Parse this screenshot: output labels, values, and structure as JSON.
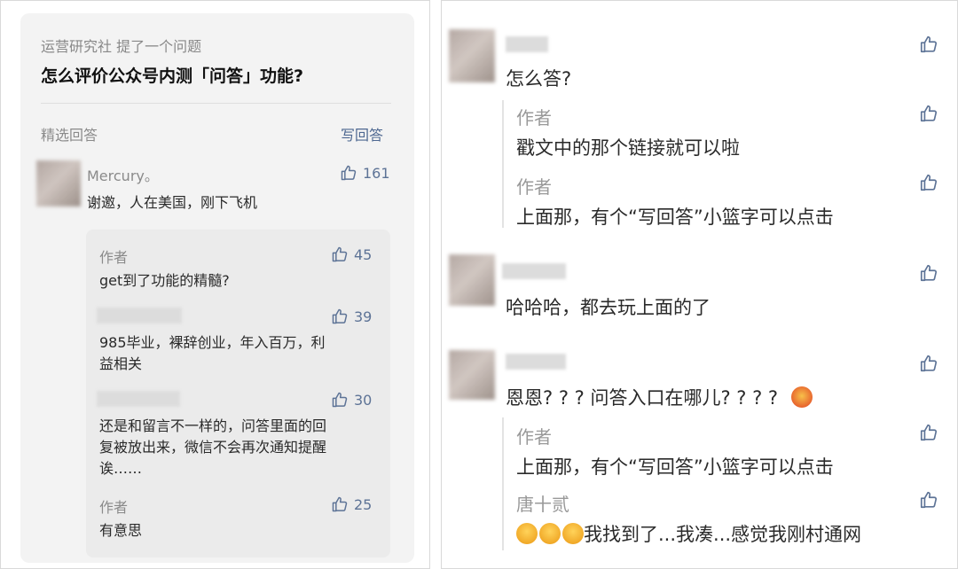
{
  "left": {
    "question": {
      "asker": "运营研究社 提了一个问题",
      "title": "怎么评价公众号内测「问答」功能?"
    },
    "section_label": "精选回答",
    "write_answer": "写回答",
    "answer": {
      "author": "Mercury。",
      "likes": "161",
      "text": "谢邀，人在美国，刚下飞机"
    },
    "replies": [
      {
        "author": "作者",
        "likes": "45",
        "text": "get到了功能的精髓?"
      },
      {
        "author": "",
        "likes": "39",
        "text_lines": [
          "985毕业，裸辞创业，年入百万，利",
          "益相关"
        ]
      },
      {
        "author": "",
        "likes": "30",
        "text_lines": [
          "还是和留言不一样的，问答里面的回",
          "复被放出来，微信不会再次通知提醒",
          "诶……"
        ]
      },
      {
        "author": "作者",
        "likes": "25",
        "text": "有意思"
      }
    ]
  },
  "right": {
    "threads": [
      {
        "text": "怎么答?",
        "replies": [
          {
            "author": "作者",
            "text": "戳文中的那个链接就可以啦"
          },
          {
            "author": "作者",
            "text": "上面那，有个“写回答”小篮字可以点击"
          }
        ]
      },
      {
        "text": "哈哈哈，都去玩上面的了",
        "replies": []
      },
      {
        "text": "恩恩? ? ? 问答入口在哪儿? ? ? ?",
        "emoji": "flushed-face-emoji",
        "replies": [
          {
            "author": "作者",
            "text": "上面那，有个“写回答”小篮字可以点击"
          },
          {
            "author": "唐十贰",
            "text": "我找到了...我凑...感觉我刚村通网",
            "emoji": "tears-of-joy-emoji"
          }
        ]
      }
    ]
  },
  "colors": {
    "link": "#4e6891",
    "like": "#5d7396",
    "card": "#f3f3f3",
    "nested": "#ebebeb"
  },
  "icons": {
    "like": "thumbs-up-icon"
  }
}
